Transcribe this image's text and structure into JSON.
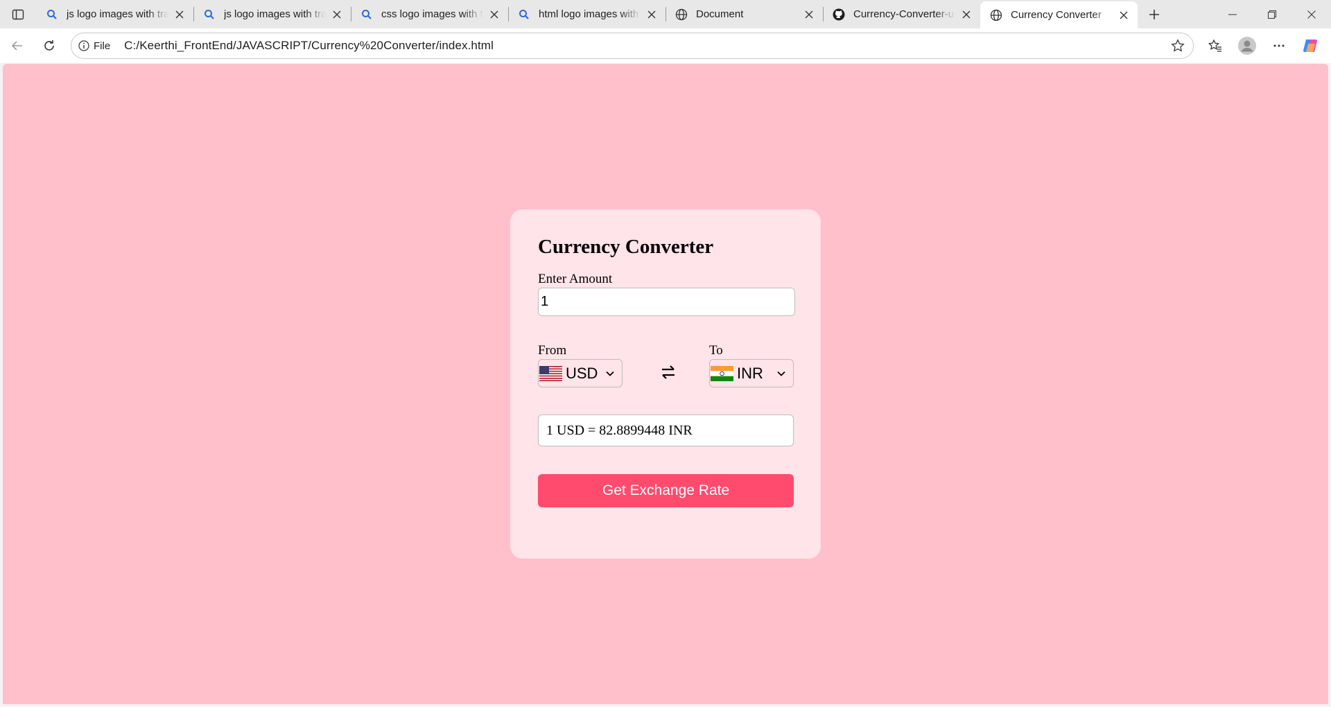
{
  "browser": {
    "tabs": [
      {
        "title": "js logo images with tra",
        "icon": "search-icon",
        "active": false
      },
      {
        "title": "js logo images with tra",
        "icon": "search-icon",
        "active": false
      },
      {
        "title": "css logo images with t",
        "icon": "search-icon",
        "active": false
      },
      {
        "title": "html logo images with",
        "icon": "search-icon",
        "active": false
      },
      {
        "title": "Document",
        "icon": "globe-icon",
        "active": false
      },
      {
        "title": "Currency-Converter-u",
        "icon": "github-icon",
        "active": false
      },
      {
        "title": "Currency Converter",
        "icon": "globe-icon",
        "active": true
      }
    ],
    "address": {
      "site_info_label": "File",
      "url": "C:/Keerthi_FrontEnd/JAVASCRIPT/Currency%20Converter/index.html"
    }
  },
  "page": {
    "background_color": "#ffc0cb",
    "card_color": "#ffe4e9",
    "title": "Currency Converter",
    "amount_label": "Enter Amount",
    "amount_value": "1",
    "from_label": "From",
    "from_currency": "USD",
    "to_label": "To",
    "to_currency": "INR",
    "result_text": "1 USD = 82.8899448 INR",
    "button_label": "Get Exchange Rate",
    "button_color": "#ff4b6e"
  }
}
